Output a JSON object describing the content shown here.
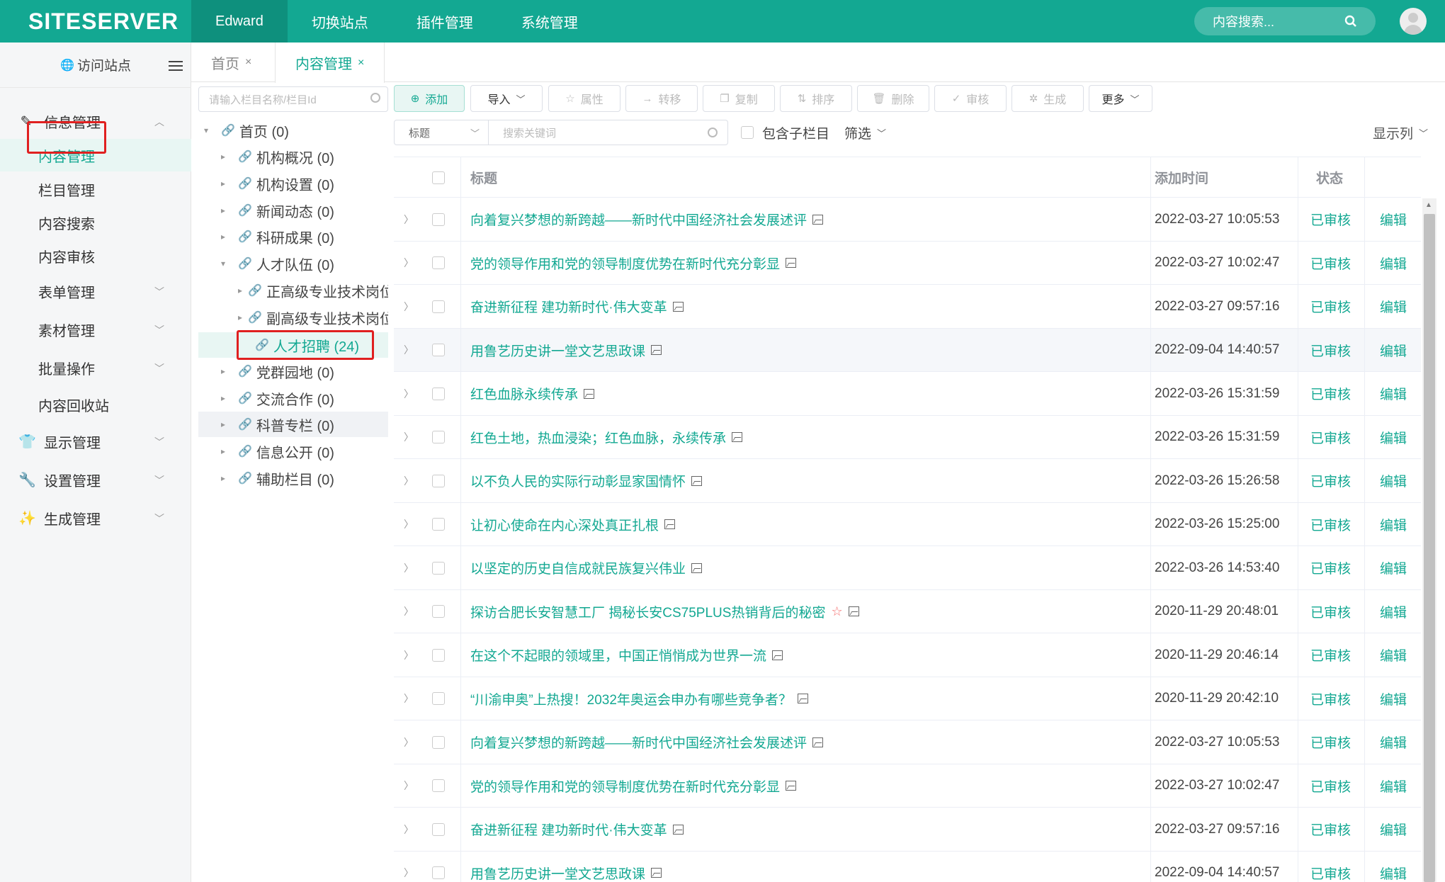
{
  "header": {
    "logo": "SITESERVER",
    "nav": [
      "Edward",
      "切换站点",
      "插件管理",
      "系统管理"
    ],
    "search_placeholder": "内容搜索..."
  },
  "sidebar": {
    "visit_site": "访问站点",
    "groups": [
      {
        "label": "信息管理",
        "icon": "edit-icon"
      },
      {
        "label": "显示管理",
        "icon": "shirt-icon"
      },
      {
        "label": "设置管理",
        "icon": "wrench-icon"
      },
      {
        "label": "生成管理",
        "icon": "magic-wand-icon"
      }
    ],
    "submenu": [
      "内容管理",
      "栏目管理",
      "内容搜索",
      "内容审核",
      "表单管理",
      "素材管理",
      "批量操作",
      "内容回收站"
    ]
  },
  "tabs": [
    {
      "label": "首页",
      "close": "×"
    },
    {
      "label": "内容管理",
      "close": "×"
    }
  ],
  "tree": {
    "search_placeholder": "请输入栏目名称/栏目Id",
    "nodes": [
      {
        "label": "首页 (0)",
        "caret": "▾"
      },
      {
        "label": "机构概况 (0)",
        "caret": "▸"
      },
      {
        "label": "机构设置 (0)",
        "caret": "▸"
      },
      {
        "label": "新闻动态 (0)",
        "caret": "▸"
      },
      {
        "label": "科研成果 (0)",
        "caret": "▸"
      },
      {
        "label": "人才队伍 (0)",
        "caret": "▾"
      },
      {
        "label": "正高级专业技术岗位",
        "caret": "▸"
      },
      {
        "label": "副高级专业技术岗位",
        "caret": "▸"
      },
      {
        "label": "人才招聘 (24)",
        "caret": ""
      },
      {
        "label": "党群园地 (0)",
        "caret": "▸"
      },
      {
        "label": "交流合作 (0)",
        "caret": "▸"
      },
      {
        "label": "科普专栏 (0)",
        "caret": "▸"
      },
      {
        "label": "信息公开 (0)",
        "caret": "▸"
      },
      {
        "label": "辅助栏目 (0)",
        "caret": "▸"
      }
    ]
  },
  "toolbar": {
    "add": "添加",
    "import": "导入",
    "attributes": "属性",
    "transfer": "转移",
    "copy": "复制",
    "sort": "排序",
    "delete": "删除",
    "review": "审核",
    "generate": "生成",
    "more": "更多"
  },
  "filter": {
    "field": "标题",
    "keyword_placeholder": "搜索关键词",
    "include_sub": "包含子栏目",
    "filter_label": "筛选",
    "show_columns": "显示列"
  },
  "table": {
    "headers": {
      "title": "标题",
      "added": "添加时间",
      "status": "状态"
    },
    "rows": [
      {
        "title": "向着复兴梦想的新跨越——新时代中国经济社会发展述评",
        "date": "2022-03-27 10:05:53",
        "status": "已审核",
        "action": "编辑",
        "star": false
      },
      {
        "title": "党的领导作用和党的领导制度优势在新时代充分彰显",
        "date": "2022-03-27 10:02:47",
        "status": "已审核",
        "action": "编辑",
        "star": false
      },
      {
        "title": "奋进新征程 建功新时代·伟大变革",
        "date": "2022-03-27 09:57:16",
        "status": "已审核",
        "action": "编辑",
        "star": false
      },
      {
        "title": "用鲁艺历史讲一堂文艺思政课",
        "date": "2022-09-04 14:40:57",
        "status": "已审核",
        "action": "编辑",
        "star": false
      },
      {
        "title": "红色血脉永续传承",
        "date": "2022-03-26 15:31:59",
        "status": "已审核",
        "action": "编辑",
        "star": false
      },
      {
        "title": "红色土地，热血浸染；红色血脉，永续传承",
        "date": "2022-03-26 15:31:59",
        "status": "已审核",
        "action": "编辑",
        "star": false
      },
      {
        "title": "以不负人民的实际行动彰显家国情怀",
        "date": "2022-03-26 15:26:58",
        "status": "已审核",
        "action": "编辑",
        "star": false
      },
      {
        "title": "让初心使命在内心深处真正扎根",
        "date": "2022-03-26 15:25:00",
        "status": "已审核",
        "action": "编辑",
        "star": false
      },
      {
        "title": "以坚定的历史自信成就民族复兴伟业",
        "date": "2022-03-26 14:53:40",
        "status": "已审核",
        "action": "编辑",
        "star": false
      },
      {
        "title": "探访合肥长安智慧工厂 揭秘长安CS75PLUS热销背后的秘密",
        "date": "2020-11-29 20:48:01",
        "status": "已审核",
        "action": "编辑",
        "star": true
      },
      {
        "title": "在这个不起眼的领域里，中国正悄悄成为世界一流",
        "date": "2020-11-29 20:46:14",
        "status": "已审核",
        "action": "编辑",
        "star": false
      },
      {
        "title": "“川渝申奥”上热搜！2032年奥运会申办有哪些竞争者？",
        "date": "2020-11-29 20:42:10",
        "status": "已审核",
        "action": "编辑",
        "star": false
      },
      {
        "title": "向着复兴梦想的新跨越——新时代中国经济社会发展述评",
        "date": "2022-03-27 10:05:53",
        "status": "已审核",
        "action": "编辑",
        "star": false
      },
      {
        "title": "党的领导作用和党的领导制度优势在新时代充分彰显",
        "date": "2022-03-27 10:02:47",
        "status": "已审核",
        "action": "编辑",
        "star": false
      },
      {
        "title": "奋进新征程 建功新时代·伟大变革",
        "date": "2022-03-27 09:57:16",
        "status": "已审核",
        "action": "编辑",
        "star": false
      },
      {
        "title": "用鲁艺历史讲一堂文艺思政课",
        "date": "2022-09-04 14:40:57",
        "status": "已审核",
        "action": "编辑",
        "star": false
      }
    ]
  }
}
